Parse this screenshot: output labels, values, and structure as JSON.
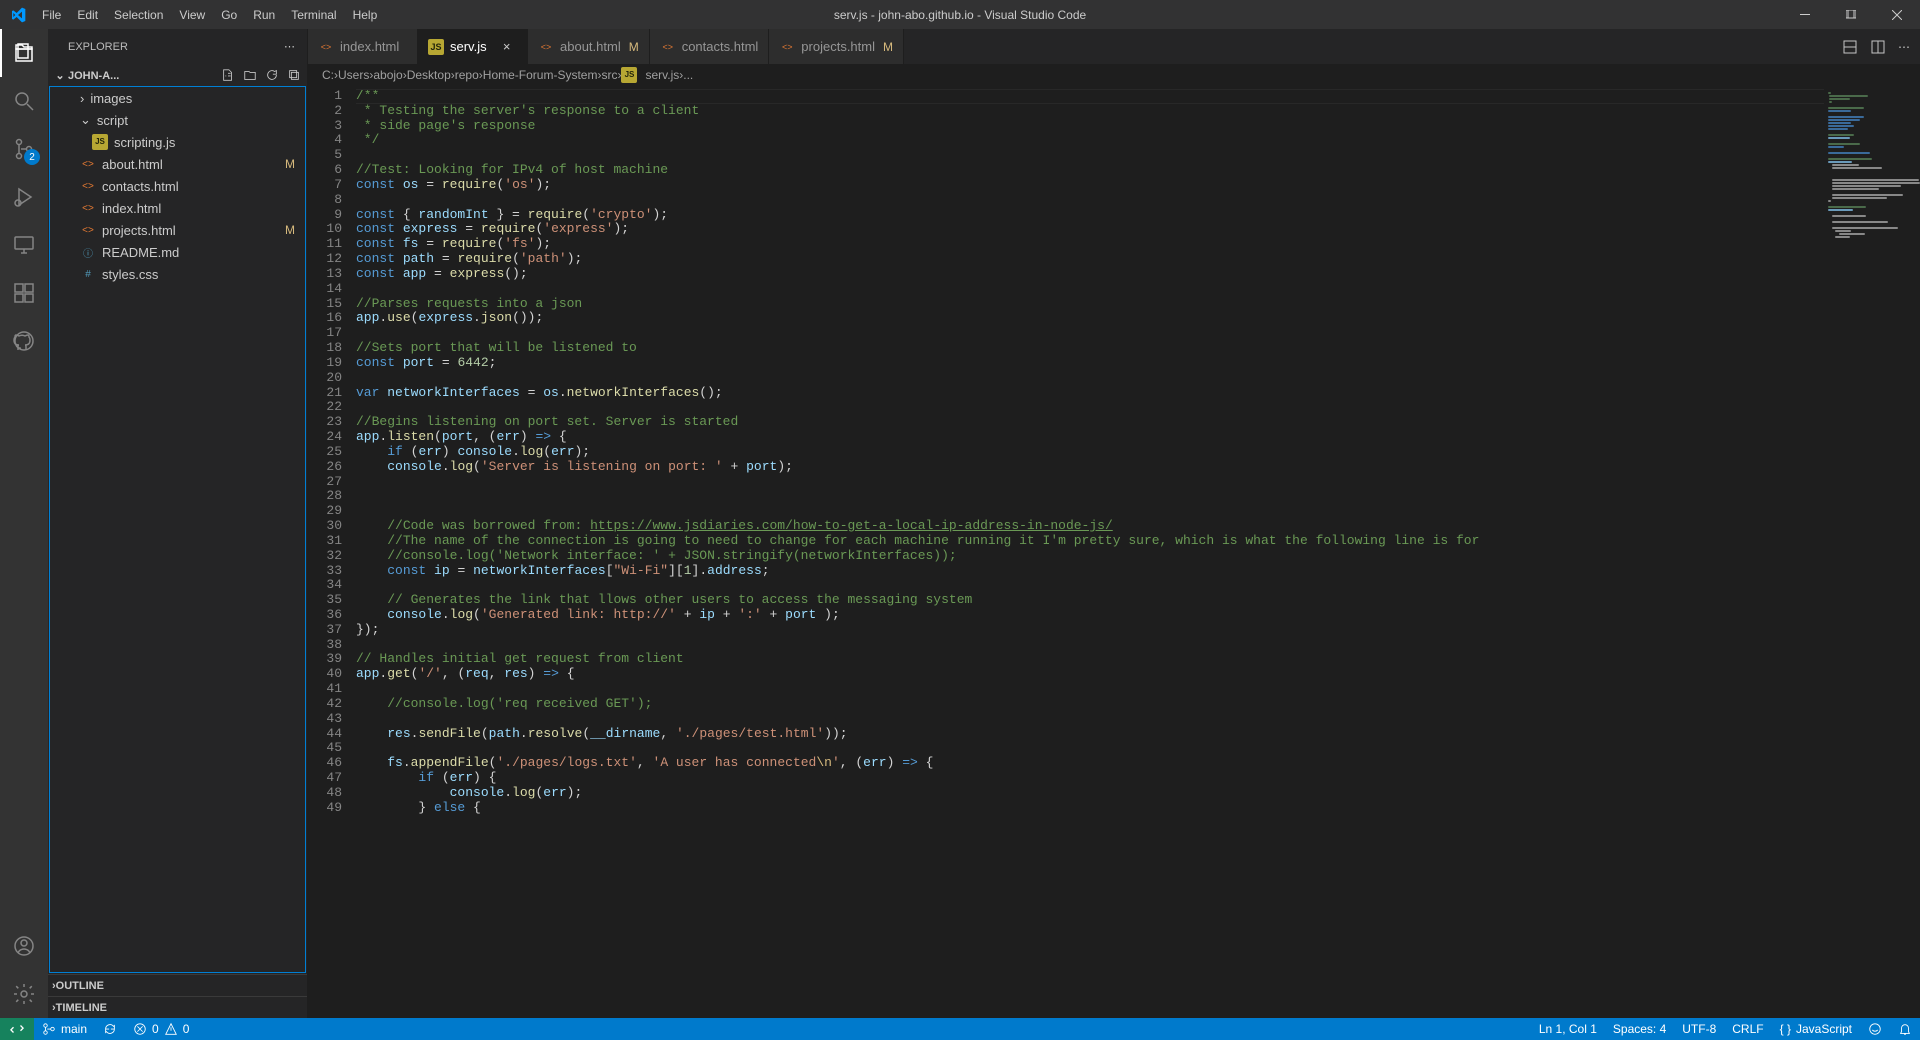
{
  "window": {
    "title": "serv.js - john-abo.github.io - Visual Studio Code"
  },
  "menu": [
    "File",
    "Edit",
    "Selection",
    "View",
    "Go",
    "Run",
    "Terminal",
    "Help"
  ],
  "activity": {
    "scm_badge": "2"
  },
  "explorer": {
    "title": "EXPLORER",
    "folder": "JOHN-A...",
    "tree": {
      "images": "images",
      "script": "script",
      "scriptingjs": "scripting.js",
      "about": "about.html",
      "contacts": "contacts.html",
      "index": "index.html",
      "projects": "projects.html",
      "readme": "README.md",
      "styles": "styles.css"
    },
    "outline": "OUTLINE",
    "timeline": "TIMELINE"
  },
  "tabs": {
    "index": "index.html",
    "serv": "serv.js",
    "about": "about.html",
    "contacts": "contacts.html",
    "projects": "projects.html",
    "mod": "M"
  },
  "breadcrumbs": [
    "C:",
    "Users",
    "abojo",
    "Desktop",
    "repo",
    "Home-Forum-System",
    "src",
    "serv.js",
    "..."
  ],
  "status": {
    "branch": "main",
    "sync": "",
    "errors": "0",
    "warnings": "0",
    "lncol": "Ln 1, Col 1",
    "spaces": "Spaces: 4",
    "encoding": "UTF-8",
    "eol": "CRLF",
    "lang": "JavaScript"
  },
  "code_lines": [
    [
      [
        "com",
        "/**"
      ]
    ],
    [
      [
        "com",
        " * Testing the server's response to a client"
      ]
    ],
    [
      [
        "com",
        " * side page's response"
      ]
    ],
    [
      [
        "com",
        " */"
      ]
    ],
    [],
    [
      [
        "com",
        "//Test: Looking for IPv4 of host machine"
      ]
    ],
    [
      [
        "kw",
        "const"
      ],
      [
        "pun",
        " "
      ],
      [
        "var",
        "os"
      ],
      [
        "pun",
        " = "
      ],
      [
        "fn",
        "require"
      ],
      [
        "pun",
        "("
      ],
      [
        "str",
        "'os'"
      ],
      [
        "pun",
        ");"
      ]
    ],
    [],
    [
      [
        "kw",
        "const"
      ],
      [
        "pun",
        " { "
      ],
      [
        "var",
        "randomInt"
      ],
      [
        "pun",
        " } = "
      ],
      [
        "fn",
        "require"
      ],
      [
        "pun",
        "("
      ],
      [
        "str",
        "'crypto'"
      ],
      [
        "pun",
        ");"
      ]
    ],
    [
      [
        "kw",
        "const"
      ],
      [
        "pun",
        " "
      ],
      [
        "var",
        "express"
      ],
      [
        "pun",
        " = "
      ],
      [
        "fn",
        "require"
      ],
      [
        "pun",
        "("
      ],
      [
        "str",
        "'express'"
      ],
      [
        "pun",
        ");"
      ]
    ],
    [
      [
        "kw",
        "const"
      ],
      [
        "pun",
        " "
      ],
      [
        "var",
        "fs"
      ],
      [
        "pun",
        " = "
      ],
      [
        "fn",
        "require"
      ],
      [
        "pun",
        "("
      ],
      [
        "str",
        "'fs'"
      ],
      [
        "pun",
        ");"
      ]
    ],
    [
      [
        "kw",
        "const"
      ],
      [
        "pun",
        " "
      ],
      [
        "var",
        "path"
      ],
      [
        "pun",
        " = "
      ],
      [
        "fn",
        "require"
      ],
      [
        "pun",
        "("
      ],
      [
        "str",
        "'path'"
      ],
      [
        "pun",
        ");"
      ]
    ],
    [
      [
        "kw",
        "const"
      ],
      [
        "pun",
        " "
      ],
      [
        "var",
        "app"
      ],
      [
        "pun",
        " = "
      ],
      [
        "fn",
        "express"
      ],
      [
        "pun",
        "();"
      ]
    ],
    [],
    [
      [
        "com",
        "//Parses requests into a json"
      ]
    ],
    [
      [
        "var",
        "app"
      ],
      [
        "pun",
        "."
      ],
      [
        "fn",
        "use"
      ],
      [
        "pun",
        "("
      ],
      [
        "var",
        "express"
      ],
      [
        "pun",
        "."
      ],
      [
        "fn",
        "json"
      ],
      [
        "pun",
        "());"
      ]
    ],
    [],
    [
      [
        "com",
        "//Sets port that will be listened to"
      ]
    ],
    [
      [
        "kw",
        "const"
      ],
      [
        "pun",
        " "
      ],
      [
        "var",
        "port"
      ],
      [
        "pun",
        " = "
      ],
      [
        "num",
        "6442"
      ],
      [
        "pun",
        ";"
      ]
    ],
    [],
    [
      [
        "kw",
        "var"
      ],
      [
        "pun",
        " "
      ],
      [
        "var",
        "networkInterfaces"
      ],
      [
        "pun",
        " = "
      ],
      [
        "var",
        "os"
      ],
      [
        "pun",
        "."
      ],
      [
        "fn",
        "networkInterfaces"
      ],
      [
        "pun",
        "();"
      ]
    ],
    [],
    [
      [
        "com",
        "//Begins listening on port set. Server is started"
      ]
    ],
    [
      [
        "var",
        "app"
      ],
      [
        "pun",
        "."
      ],
      [
        "fn",
        "listen"
      ],
      [
        "pun",
        "("
      ],
      [
        "var",
        "port"
      ],
      [
        "pun",
        ", ("
      ],
      [
        "var",
        "err"
      ],
      [
        "pun",
        ") "
      ],
      [
        "kw",
        "=>"
      ],
      [
        "pun",
        " {"
      ]
    ],
    [
      [
        "pun",
        "    "
      ],
      [
        "kw",
        "if"
      ],
      [
        "pun",
        " ("
      ],
      [
        "var",
        "err"
      ],
      [
        "pun",
        ") "
      ],
      [
        "var",
        "console"
      ],
      [
        "pun",
        "."
      ],
      [
        "fn",
        "log"
      ],
      [
        "pun",
        "("
      ],
      [
        "var",
        "err"
      ],
      [
        "pun",
        ");"
      ]
    ],
    [
      [
        "pun",
        "    "
      ],
      [
        "var",
        "console"
      ],
      [
        "pun",
        "."
      ],
      [
        "fn",
        "log"
      ],
      [
        "pun",
        "("
      ],
      [
        "str",
        "'Server is listening on port: '"
      ],
      [
        "pun",
        " + "
      ],
      [
        "var",
        "port"
      ],
      [
        "pun",
        ");"
      ]
    ],
    [],
    [],
    [],
    [
      [
        "pun",
        "    "
      ],
      [
        "com",
        "//Code was borrowed from: "
      ],
      [
        "link",
        "https://www.jsdiaries.com/how-to-get-a-local-ip-address-in-node-js/"
      ]
    ],
    [
      [
        "pun",
        "    "
      ],
      [
        "com",
        "//The name of the connection is going to need to change for each machine running it I'm pretty sure, which is what the following line is for"
      ]
    ],
    [
      [
        "pun",
        "    "
      ],
      [
        "com",
        "//console.log('Network interface: ' + JSON.stringify(networkInterfaces));"
      ]
    ],
    [
      [
        "pun",
        "    "
      ],
      [
        "kw",
        "const"
      ],
      [
        "pun",
        " "
      ],
      [
        "var",
        "ip"
      ],
      [
        "pun",
        " = "
      ],
      [
        "var",
        "networkInterfaces"
      ],
      [
        "pun",
        "["
      ],
      [
        "str",
        "\"Wi-Fi\""
      ],
      [
        "pun",
        "]["
      ],
      [
        "num",
        "1"
      ],
      [
        "pun",
        "]."
      ],
      [
        "prop",
        "address"
      ],
      [
        "pun",
        ";"
      ]
    ],
    [],
    [
      [
        "pun",
        "    "
      ],
      [
        "com",
        "// Generates the link that llows other users to access the messaging system"
      ]
    ],
    [
      [
        "pun",
        "    "
      ],
      [
        "var",
        "console"
      ],
      [
        "pun",
        "."
      ],
      [
        "fn",
        "log"
      ],
      [
        "pun",
        "("
      ],
      [
        "str",
        "'Generated link: http://'"
      ],
      [
        "pun",
        " + "
      ],
      [
        "var",
        "ip"
      ],
      [
        "pun",
        " + "
      ],
      [
        "str",
        "':'"
      ],
      [
        "pun",
        " + "
      ],
      [
        "var",
        "port"
      ],
      [
        "pun",
        " );"
      ]
    ],
    [
      [
        "pun",
        "});"
      ]
    ],
    [],
    [
      [
        "com",
        "// Handles initial get request from client"
      ]
    ],
    [
      [
        "var",
        "app"
      ],
      [
        "pun",
        "."
      ],
      [
        "fn",
        "get"
      ],
      [
        "pun",
        "("
      ],
      [
        "str",
        "'/'"
      ],
      [
        "pun",
        ", ("
      ],
      [
        "var",
        "req"
      ],
      [
        "pun",
        ", "
      ],
      [
        "var",
        "res"
      ],
      [
        "pun",
        ") "
      ],
      [
        "kw",
        "=>"
      ],
      [
        "pun",
        " {"
      ]
    ],
    [],
    [
      [
        "pun",
        "    "
      ],
      [
        "com",
        "//console.log('req received GET');"
      ]
    ],
    [],
    [
      [
        "pun",
        "    "
      ],
      [
        "var",
        "res"
      ],
      [
        "pun",
        "."
      ],
      [
        "fn",
        "sendFile"
      ],
      [
        "pun",
        "("
      ],
      [
        "var",
        "path"
      ],
      [
        "pun",
        "."
      ],
      [
        "fn",
        "resolve"
      ],
      [
        "pun",
        "("
      ],
      [
        "var",
        "__dirname"
      ],
      [
        "pun",
        ", "
      ],
      [
        "str",
        "'./pages/test.html'"
      ],
      [
        "pun",
        "));"
      ]
    ],
    [],
    [
      [
        "pun",
        "    "
      ],
      [
        "var",
        "fs"
      ],
      [
        "pun",
        "."
      ],
      [
        "fn",
        "appendFile"
      ],
      [
        "pun",
        "("
      ],
      [
        "str",
        "'./pages/logs.txt'"
      ],
      [
        "pun",
        ", "
      ],
      [
        "str",
        "'A user has connected"
      ],
      [
        "esc",
        "\\n"
      ],
      [
        "str",
        "'"
      ],
      [
        "pun",
        ", ("
      ],
      [
        "var",
        "err"
      ],
      [
        "pun",
        ") "
      ],
      [
        "kw",
        "=>"
      ],
      [
        "pun",
        " {"
      ]
    ],
    [
      [
        "pun",
        "        "
      ],
      [
        "kw",
        "if"
      ],
      [
        "pun",
        " ("
      ],
      [
        "var",
        "err"
      ],
      [
        "pun",
        ") {"
      ]
    ],
    [
      [
        "pun",
        "            "
      ],
      [
        "var",
        "console"
      ],
      [
        "pun",
        "."
      ],
      [
        "fn",
        "log"
      ],
      [
        "pun",
        "("
      ],
      [
        "var",
        "err"
      ],
      [
        "pun",
        ");"
      ]
    ],
    [
      [
        "pun",
        "        } "
      ],
      [
        "kw",
        "else"
      ],
      [
        "pun",
        " {"
      ]
    ]
  ]
}
